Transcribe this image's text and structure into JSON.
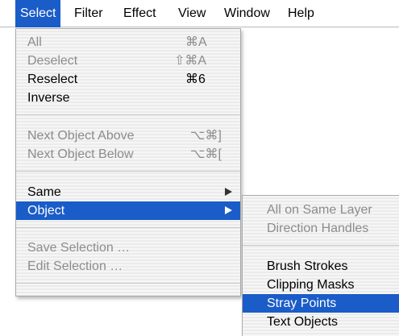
{
  "menubar": {
    "items": [
      "Select",
      "Filter",
      "Effect",
      "View",
      "Window",
      "Help"
    ]
  },
  "select_menu": {
    "all": {
      "label": "All",
      "shortcut": "⌘A"
    },
    "deselect": {
      "label": "Deselect",
      "shortcut": "⇧⌘A"
    },
    "reselect": {
      "label": "Reselect",
      "shortcut": "⌘6"
    },
    "inverse": {
      "label": "Inverse"
    },
    "next_above": {
      "label": "Next Object Above",
      "shortcut": "⌥⌘]"
    },
    "next_below": {
      "label": "Next Object Below",
      "shortcut": "⌥⌘["
    },
    "same": {
      "label": "Same"
    },
    "object": {
      "label": "Object"
    },
    "save_selection": {
      "label": "Save Selection …"
    },
    "edit_selection": {
      "label": "Edit Selection …"
    }
  },
  "object_submenu": {
    "all_same_layer": "All on Same Layer",
    "direction_handles": "Direction Handles",
    "brush_strokes": "Brush Strokes",
    "clipping_masks": "Clipping Masks",
    "stray_points": "Stray Points",
    "text_objects": "Text Objects"
  },
  "colors": {
    "highlight": "#1a5cc8",
    "disabled_text": "#8c8c8c"
  }
}
